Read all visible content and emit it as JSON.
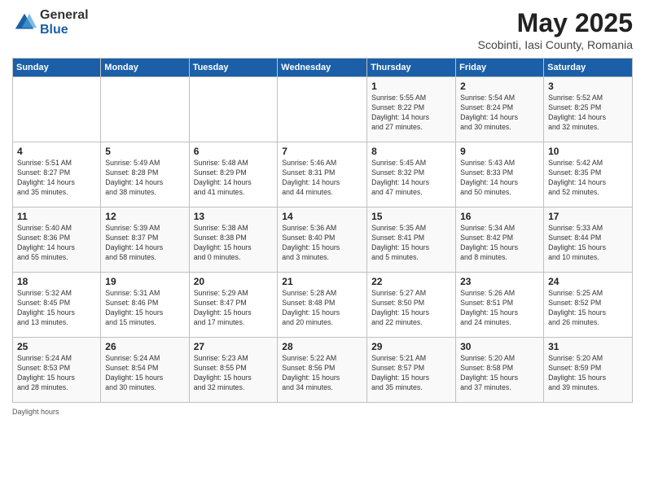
{
  "header": {
    "logo_general": "General",
    "logo_blue": "Blue",
    "title": "May 2025",
    "subtitle": "Scobinti, Iasi County, Romania"
  },
  "days_of_week": [
    "Sunday",
    "Monday",
    "Tuesday",
    "Wednesday",
    "Thursday",
    "Friday",
    "Saturday"
  ],
  "weeks": [
    [
      {
        "day": "",
        "info": ""
      },
      {
        "day": "",
        "info": ""
      },
      {
        "day": "",
        "info": ""
      },
      {
        "day": "",
        "info": ""
      },
      {
        "day": "1",
        "info": "Sunrise: 5:55 AM\nSunset: 8:22 PM\nDaylight: 14 hours\nand 27 minutes."
      },
      {
        "day": "2",
        "info": "Sunrise: 5:54 AM\nSunset: 8:24 PM\nDaylight: 14 hours\nand 30 minutes."
      },
      {
        "day": "3",
        "info": "Sunrise: 5:52 AM\nSunset: 8:25 PM\nDaylight: 14 hours\nand 32 minutes."
      }
    ],
    [
      {
        "day": "4",
        "info": "Sunrise: 5:51 AM\nSunset: 8:27 PM\nDaylight: 14 hours\nand 35 minutes."
      },
      {
        "day": "5",
        "info": "Sunrise: 5:49 AM\nSunset: 8:28 PM\nDaylight: 14 hours\nand 38 minutes."
      },
      {
        "day": "6",
        "info": "Sunrise: 5:48 AM\nSunset: 8:29 PM\nDaylight: 14 hours\nand 41 minutes."
      },
      {
        "day": "7",
        "info": "Sunrise: 5:46 AM\nSunset: 8:31 PM\nDaylight: 14 hours\nand 44 minutes."
      },
      {
        "day": "8",
        "info": "Sunrise: 5:45 AM\nSunset: 8:32 PM\nDaylight: 14 hours\nand 47 minutes."
      },
      {
        "day": "9",
        "info": "Sunrise: 5:43 AM\nSunset: 8:33 PM\nDaylight: 14 hours\nand 50 minutes."
      },
      {
        "day": "10",
        "info": "Sunrise: 5:42 AM\nSunset: 8:35 PM\nDaylight: 14 hours\nand 52 minutes."
      }
    ],
    [
      {
        "day": "11",
        "info": "Sunrise: 5:40 AM\nSunset: 8:36 PM\nDaylight: 14 hours\nand 55 minutes."
      },
      {
        "day": "12",
        "info": "Sunrise: 5:39 AM\nSunset: 8:37 PM\nDaylight: 14 hours\nand 58 minutes."
      },
      {
        "day": "13",
        "info": "Sunrise: 5:38 AM\nSunset: 8:38 PM\nDaylight: 15 hours\nand 0 minutes."
      },
      {
        "day": "14",
        "info": "Sunrise: 5:36 AM\nSunset: 8:40 PM\nDaylight: 15 hours\nand 3 minutes."
      },
      {
        "day": "15",
        "info": "Sunrise: 5:35 AM\nSunset: 8:41 PM\nDaylight: 15 hours\nand 5 minutes."
      },
      {
        "day": "16",
        "info": "Sunrise: 5:34 AM\nSunset: 8:42 PM\nDaylight: 15 hours\nand 8 minutes."
      },
      {
        "day": "17",
        "info": "Sunrise: 5:33 AM\nSunset: 8:44 PM\nDaylight: 15 hours\nand 10 minutes."
      }
    ],
    [
      {
        "day": "18",
        "info": "Sunrise: 5:32 AM\nSunset: 8:45 PM\nDaylight: 15 hours\nand 13 minutes."
      },
      {
        "day": "19",
        "info": "Sunrise: 5:31 AM\nSunset: 8:46 PM\nDaylight: 15 hours\nand 15 minutes."
      },
      {
        "day": "20",
        "info": "Sunrise: 5:29 AM\nSunset: 8:47 PM\nDaylight: 15 hours\nand 17 minutes."
      },
      {
        "day": "21",
        "info": "Sunrise: 5:28 AM\nSunset: 8:48 PM\nDaylight: 15 hours\nand 20 minutes."
      },
      {
        "day": "22",
        "info": "Sunrise: 5:27 AM\nSunset: 8:50 PM\nDaylight: 15 hours\nand 22 minutes."
      },
      {
        "day": "23",
        "info": "Sunrise: 5:26 AM\nSunset: 8:51 PM\nDaylight: 15 hours\nand 24 minutes."
      },
      {
        "day": "24",
        "info": "Sunrise: 5:25 AM\nSunset: 8:52 PM\nDaylight: 15 hours\nand 26 minutes."
      }
    ],
    [
      {
        "day": "25",
        "info": "Sunrise: 5:24 AM\nSunset: 8:53 PM\nDaylight: 15 hours\nand 28 minutes."
      },
      {
        "day": "26",
        "info": "Sunrise: 5:24 AM\nSunset: 8:54 PM\nDaylight: 15 hours\nand 30 minutes."
      },
      {
        "day": "27",
        "info": "Sunrise: 5:23 AM\nSunset: 8:55 PM\nDaylight: 15 hours\nand 32 minutes."
      },
      {
        "day": "28",
        "info": "Sunrise: 5:22 AM\nSunset: 8:56 PM\nDaylight: 15 hours\nand 34 minutes."
      },
      {
        "day": "29",
        "info": "Sunrise: 5:21 AM\nSunset: 8:57 PM\nDaylight: 15 hours\nand 35 minutes."
      },
      {
        "day": "30",
        "info": "Sunrise: 5:20 AM\nSunset: 8:58 PM\nDaylight: 15 hours\nand 37 minutes."
      },
      {
        "day": "31",
        "info": "Sunrise: 5:20 AM\nSunset: 8:59 PM\nDaylight: 15 hours\nand 39 minutes."
      }
    ]
  ],
  "footer": "Daylight hours"
}
